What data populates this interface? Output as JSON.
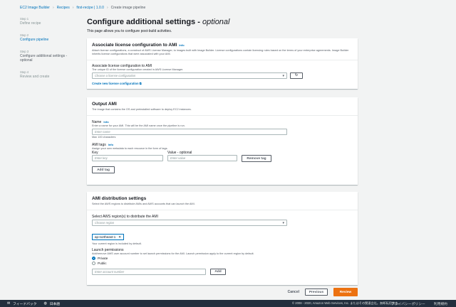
{
  "breadcrumb": {
    "items": [
      "EC2 Image Builder",
      "Recipes",
      "first-recipe | 1.0.0"
    ],
    "current": "Create image pipeline"
  },
  "steps": [
    {
      "num": "Step 1",
      "label": "Define recipe"
    },
    {
      "num": "Step 2",
      "label": "Configure pipeline"
    },
    {
      "num": "Step 3",
      "label": "Configure additional settings - optional"
    },
    {
      "num": "Step 4",
      "label": "Review and create"
    }
  ],
  "page": {
    "title": "Configure additional settings - ",
    "title_optional": "optional",
    "subtitle": "This page allows you to configure post-build activities."
  },
  "license": {
    "title": "Associate license configuration to AMI",
    "info": "Info",
    "description": "Attach license configurations, a construct of AWS License Manager, to images built with Image Builder. License configurations contain licensing rules based on the terms of your enterprise agreements. Image Builder inherits license configurations that were associated with your AMI.",
    "field_label": "Associate license configuration to AMI",
    "field_hint": "The unique ID of the license configuration created in AWS License Manager.",
    "placeholder": "Choose a license configuration",
    "create_link": "Create new license configuration"
  },
  "output": {
    "title": "Output AMI",
    "description": "The image that contains the OS and preinstalled software to deploy EC2 instances.",
    "name_label": "Name",
    "name_info": "Info",
    "name_hint": "Enter a name for your AMI. This will be the AMI name once the pipeline is run.",
    "name_placeholder": "Enter name",
    "name_constraint": "Max 100 characters",
    "tags_label": "AMI tags",
    "tags_info": "Info",
    "tags_hint": "Assign your own metadata to each resource in the form of tags.",
    "key_label": "Key",
    "value_label": "Value - optional",
    "key_placeholder": "Enter key",
    "value_placeholder": "Enter value",
    "remove_tag": "Remove tag",
    "add_tag": "Add tag"
  },
  "distribution": {
    "title": "AMI distribution settings",
    "description": "Select the AWS regions to distribute AMIs and AWS accounts that can launch the AMI.",
    "region_label": "Select AWS region(s) to distribute the AMI",
    "region_placeholder": "Choose region",
    "selected_region": "ap-northeast-1",
    "region_note": "Your current region is included by default.",
    "launch_label": "Launch permissions",
    "launch_hint": "Add/remove AWS user account number to set launch permissions for the AMI. Launch permission apply to the current region by default.",
    "options": [
      "Private",
      "Public"
    ],
    "selected_option": "Private",
    "account_placeholder": "Enter account number",
    "add": "Add"
  },
  "actions": {
    "cancel": "Cancel",
    "previous": "Previous",
    "review": "Review"
  },
  "footer": {
    "feedback": "フィードバック",
    "language": "日本語",
    "copyright": "© 2008 - 2020, Amazon Web Services, Inc. またはその関連会社。無断転用禁止。",
    "privacy": "プライバシーポリシー",
    "terms": "利用規約"
  },
  "colors": {
    "accent": "#0073bb",
    "primary_button": "#ec7211",
    "footer_bg": "#232f3e"
  }
}
